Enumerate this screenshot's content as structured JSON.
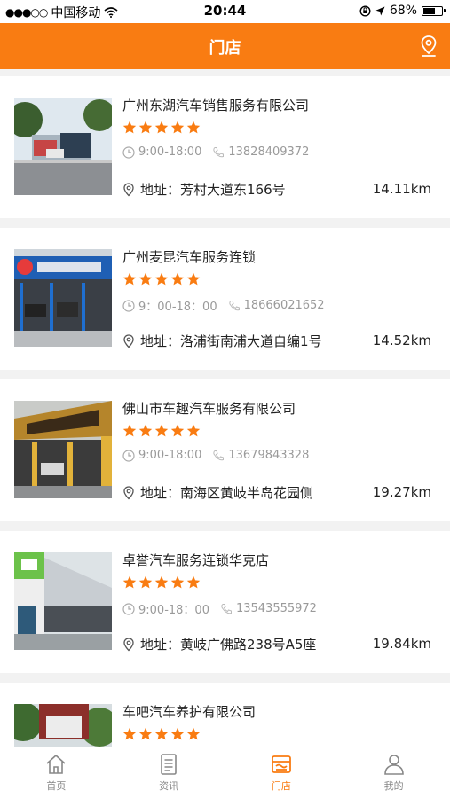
{
  "status_bar": {
    "carrier": "中国移动",
    "time": "20:44",
    "battery": "68%",
    "battery_level": 0.68
  },
  "header": {
    "title": "门店",
    "map_icon": "map-pin-icon"
  },
  "stores": [
    {
      "name": "广州东湖汽车销售服务有限公司",
      "rating": 5,
      "hours": "9:00-18:00",
      "phone": "13828409372",
      "address": "地址：芳村大道东166号",
      "distance": "14.11km"
    },
    {
      "name": "广州麦昆汽车服务连锁",
      "rating": 5,
      "hours": "9：00-18：00",
      "phone": "18666021652",
      "address": "地址：洛浦街南浦大道自编1号",
      "distance": "14.52km"
    },
    {
      "name": "佛山市车趣汽车服务有限公司",
      "rating": 5,
      "hours": "9:00-18:00",
      "phone": "13679843328",
      "address": "地址：南海区黄岐半岛花园侧",
      "distance": "19.27km"
    },
    {
      "name": "卓誉汽车服务连锁华克店",
      "rating": 5,
      "hours": "9:00-18：00",
      "phone": "13543555972",
      "address": "地址：黄岐广佛路238号A5座",
      "distance": "19.84km"
    },
    {
      "name": "车吧汽车养护有限公司",
      "rating": 5,
      "hours": "",
      "phone": "",
      "address": "",
      "distance": ""
    }
  ],
  "tabs": [
    {
      "label": "首页",
      "icon": "home-icon",
      "active": false
    },
    {
      "label": "资讯",
      "icon": "news-icon",
      "active": false
    },
    {
      "label": "门店",
      "icon": "store-icon",
      "active": true
    },
    {
      "label": "我的",
      "icon": "user-icon",
      "active": false
    }
  ],
  "colors": {
    "accent": "#f97c12",
    "muted_text": "#9a9a9a"
  }
}
